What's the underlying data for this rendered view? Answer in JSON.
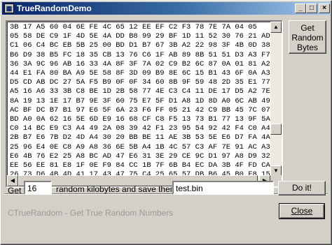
{
  "window": {
    "title": "TrueRandomDemo"
  },
  "titlebar_buttons": {
    "minimize": "_",
    "maximize": "□",
    "close": "×"
  },
  "hex": {
    "lines": [
      "3B 17 A5 60 04 6E FE 4C 65 12 EE EF C2 F3 78 7E 7A 04 05",
      "05 58 DE C9 1F 4D 5E 4A DD B8 99 29 BF 1D 11 52 30 76 21 AD",
      "C1 06 C4 BC EB 5B 25 00 BD D1 B7 67 3B A2 22 98 3F 4B 0D 38",
      "B6 D9 38 B5 FC 18 35 CB 13 76 C6 1F AB 89 8B 51 51 D3 A3 F7",
      "36 3A 9C 96 AB 16 33 4A 8F 3F 7A 02 C9 B2 6C 87 0A 01 81 A2",
      "44 E1 FA 80 BA A9 5E 58 8F 3D 09 B9 8E 6C 15 B1 43 6F 0A A3",
      "D5 CD AB DC 27 5A F5 B9 0F 0F 34 60 8B 9F 59 48 2D 35 E1 77",
      "A5 16 A6 33 3B C8 BE 1D 2B 58 77 4E C3 C4 11 DE 17 D5 A2 7E",
      "8A 19 13 1E 17 B7 9E 3F 60 75 E7 5F D1 A8 1D 8D A0 6C AB 49",
      "AC BF DC B7 B1 97 E6 5F 6A 23 F6 FF 05 21 42 C9 BB 45 7C 07",
      "BD A0 0A 62 16 5E 6D E9 16 68 CF C8 F5 13 73 B1 77 13 9F 5A",
      "C0 14 BC E9 C3 A4 49 2A 08 39 42 F1 23 95 54 92 42 F4 C0 A4",
      "2B B7 E6 7B D2 4D A4 30 20 BB BE 11 AE 3B 53 5E E6 D7 FA 4A",
      "25 96 E4 0E C8 A9 A8 36 6E 5B A4 1B 4C 57 C3 AF 7E 91 AC A3",
      "E6 4B 76 E2 25 A8 BC AD 47 E6 31 3E 29 CE 9C D1 97 A8 D9 32",
      "EE 56 EE 81 E8 1F 0E F9 84 CC 1B 7F 6B B4 EC DA 3B 4F FD CA",
      "26 73 D6 4B 4D 41 17 43 47 75 C4 25 65 57 DB B6 45 B0 F8 15"
    ],
    "scroll_up": "▲",
    "scroll_down": "▼",
    "scroll_left": "◀",
    "scroll_right": "▶"
  },
  "get_bytes_button": "Get\nRandom\nBytes",
  "form": {
    "get_label": "Get",
    "kilobytes_value": "16",
    "mid_label": "random kilobytes and save them to file:",
    "filename_value": "test.bin",
    "do_it_label": "Do it!"
  },
  "status_text": "CTrueRandom - Get True Random Numbers",
  "close_label": "Close"
}
